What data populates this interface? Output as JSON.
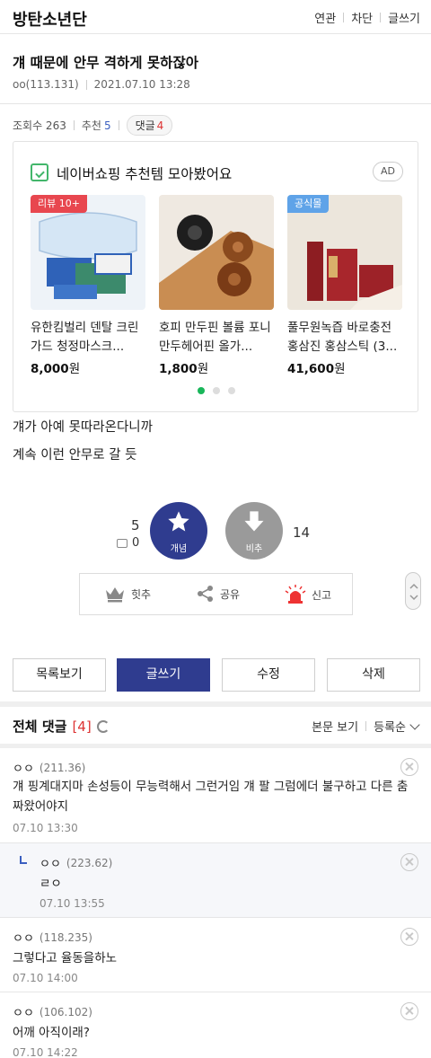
{
  "header": {
    "brand": "방탄소년단",
    "nav": [
      "연관",
      "차단",
      "글쓰기"
    ]
  },
  "post": {
    "title": "걔 때문에 안무 격하게 못하잖아",
    "author": "oo(113.131)",
    "datetime": "2021.07.10 13:28",
    "views_label": "조회수 263",
    "recommend_label": "추천",
    "recommend_count": "5",
    "comment_label": "댓글",
    "comment_count": "4",
    "body": [
      "걔가 아예 못따라온다니까",
      "계속 이런 안무로 갈 듯"
    ]
  },
  "ad": {
    "title": "네이버쇼핑 추천템 모아봤어요",
    "badge": "AD",
    "products": [
      {
        "tag": "리뷰 10+",
        "name": "유한킴벌리 덴탈 크린가드 청정마스크...",
        "price": "8,000",
        "currency": "원",
        "tag_color": "#e8474f"
      },
      {
        "tag": "",
        "name": "호피 만두핀 볼륨 포니만두헤어핀 올가...",
        "price": "1,800",
        "currency": "원",
        "tag_color": ""
      },
      {
        "tag": "공식몰",
        "name": "풀무원녹즙 바로충전 홍삼진 홍삼스틱 (3...",
        "price": "41,600",
        "currency": "원",
        "tag_color": "#5fa3e8"
      }
    ],
    "carousel_active": 0
  },
  "votes": {
    "up": "5",
    "up_label": "개념",
    "image_count": "0",
    "down": "14",
    "down_label": "비추"
  },
  "actions": {
    "hit": "힛추",
    "share": "공유",
    "report": "신고"
  },
  "buttons": {
    "list": "목록보기",
    "write": "글쓰기",
    "edit": "수정",
    "delete": "삭제"
  },
  "comments_header": {
    "title": "전체 댓글",
    "count": "[4]",
    "view_body": "본문 보기",
    "sort": "등록순"
  },
  "comments": [
    {
      "author": "ㅇㅇ",
      "ip": "(211.36)",
      "text": "걔 핑계대지마 손성등이 무능력해서 그런거임 걔 팔 그럼에더 불구하고 다른 춤 짜왔어야지",
      "date": "07.10 13:30"
    },
    {
      "author": "ㅇㅇ",
      "ip": "(223.62)",
      "text": "ㄹㅇ",
      "date": "07.10 13:55"
    },
    {
      "author": "ㅇㅇ",
      "ip": "(118.235)",
      "text": "그렇다고 율동을하노",
      "date": "07.10 14:00"
    },
    {
      "author": "ㅇㅇ",
      "ip": "(106.102)",
      "text": "어깨 아직이래?",
      "date": "07.10 14:22"
    }
  ],
  "colors": {
    "primary": "#2f3c8f",
    "accent_red": "#dd3333",
    "accent_blue": "#3b5fc0",
    "naver_green": "#19b65a"
  }
}
